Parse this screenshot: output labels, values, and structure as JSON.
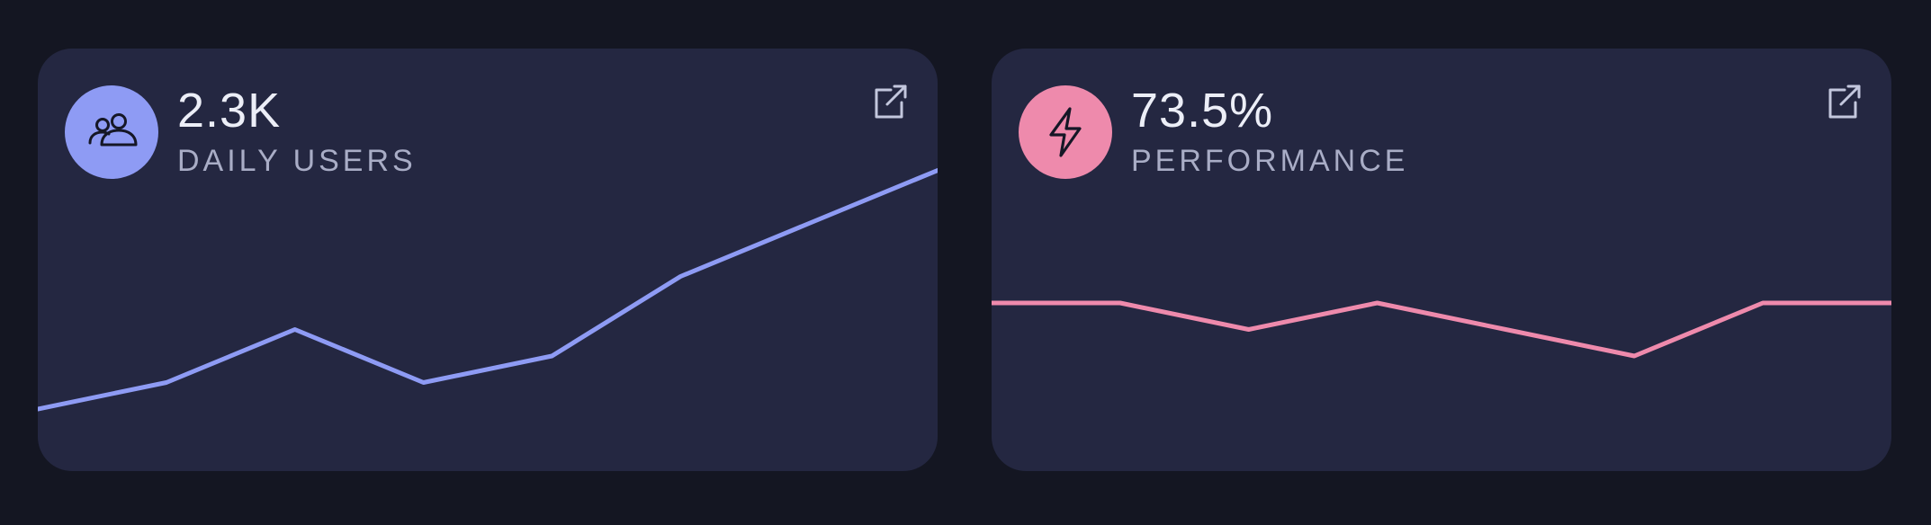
{
  "cards": [
    {
      "value": "2.3K",
      "label": "DAILY USERS",
      "icon": "users-icon",
      "accent": "#8e9bf4",
      "action_icon": "external-link-icon",
      "trend": [
        20,
        30,
        50,
        30,
        40,
        70,
        90,
        110
      ]
    },
    {
      "value": "73.5%",
      "label": "PERFORMANCE",
      "icon": "lightning-bolt-icon",
      "accent": "#ee8aac",
      "action_icon": "external-link-icon",
      "trend": [
        60,
        60,
        50,
        60,
        50,
        40,
        60,
        60
      ]
    }
  ],
  "colors": {
    "background": "#141622",
    "card": "#242741",
    "value_text": "#eceef7",
    "label_text": "#a9adc6"
  }
}
